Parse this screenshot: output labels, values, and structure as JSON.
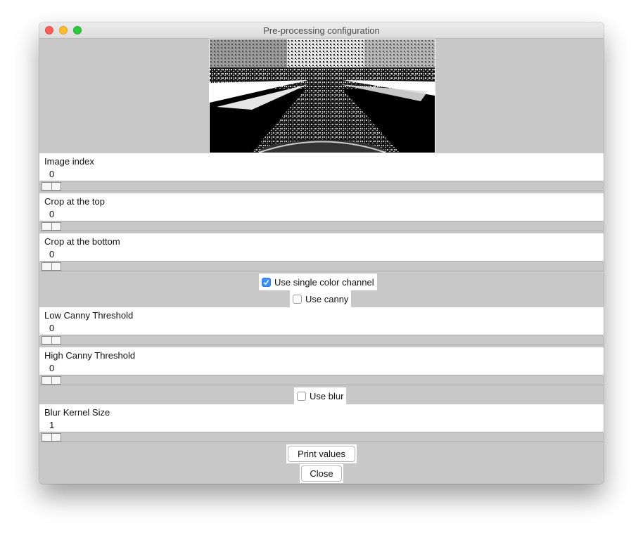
{
  "window": {
    "title": "Pre-processing configuration"
  },
  "sliders": [
    {
      "label": "Image index",
      "value": "0"
    },
    {
      "label": "Crop at the top",
      "value": "0"
    },
    {
      "label": "Crop at the bottom",
      "value": "0"
    },
    {
      "label": "Low Canny Threshold",
      "value": "0"
    },
    {
      "label": "High Canny Threshold",
      "value": "0"
    },
    {
      "label": "Blur Kernel Size",
      "value": "1"
    }
  ],
  "checkboxes": {
    "single_channel": {
      "label": "Use single color channel",
      "checked": true
    },
    "canny": {
      "label": "Use canny",
      "checked": false
    },
    "blur": {
      "label": "Use blur",
      "checked": false
    }
  },
  "buttons": {
    "print_values": "Print values",
    "close": "Close"
  },
  "colors": {
    "accent": "#3d8ff6",
    "panel": "#c8c8c8"
  }
}
